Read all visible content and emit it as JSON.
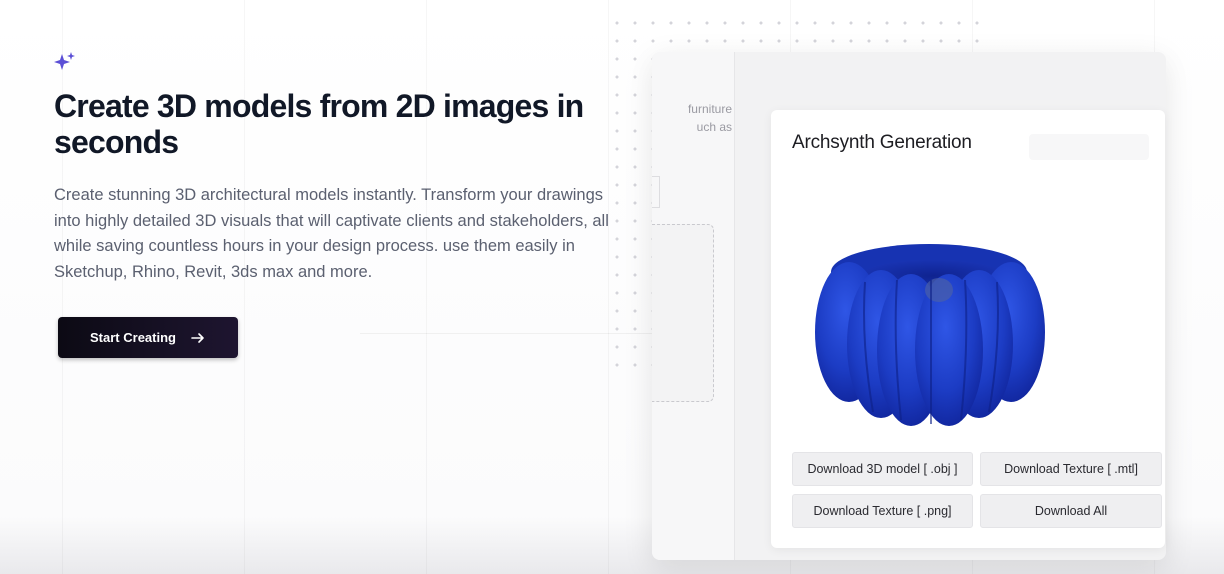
{
  "hero": {
    "headline": "Create 3D models from 2D images in seconds",
    "description": "Create stunning 3D architectural models instantly. Transform your drawings into highly detailed 3D visuals that will captivate clients and stakeholders, all while saving countless hours in your design process. use them easily in Sketchup, Rhino, Revit, 3ds max and more.",
    "cta_label": "Start Creating",
    "sparkle_icon": "sparkle-icon",
    "arrow_icon": "arrow-right-icon"
  },
  "mockup": {
    "partial_text_line1": "furniture",
    "partial_text_line2": "uch as",
    "card_title": "Archsynth Generation",
    "model_description": "blue pumpkin-shaped sofa 3D model",
    "buttons": {
      "download_obj": "Download 3D model [ .obj ]",
      "download_mtl": "Download Texture [ .mtl]",
      "download_png": "Download Texture [ .png]",
      "download_all": "Download All"
    }
  },
  "colors": {
    "accent": "#5b4fd6",
    "heading": "#111827",
    "body_text": "#5b6070",
    "cta_bg": "#0c0a14",
    "model_blue": "#1f3fc9"
  }
}
